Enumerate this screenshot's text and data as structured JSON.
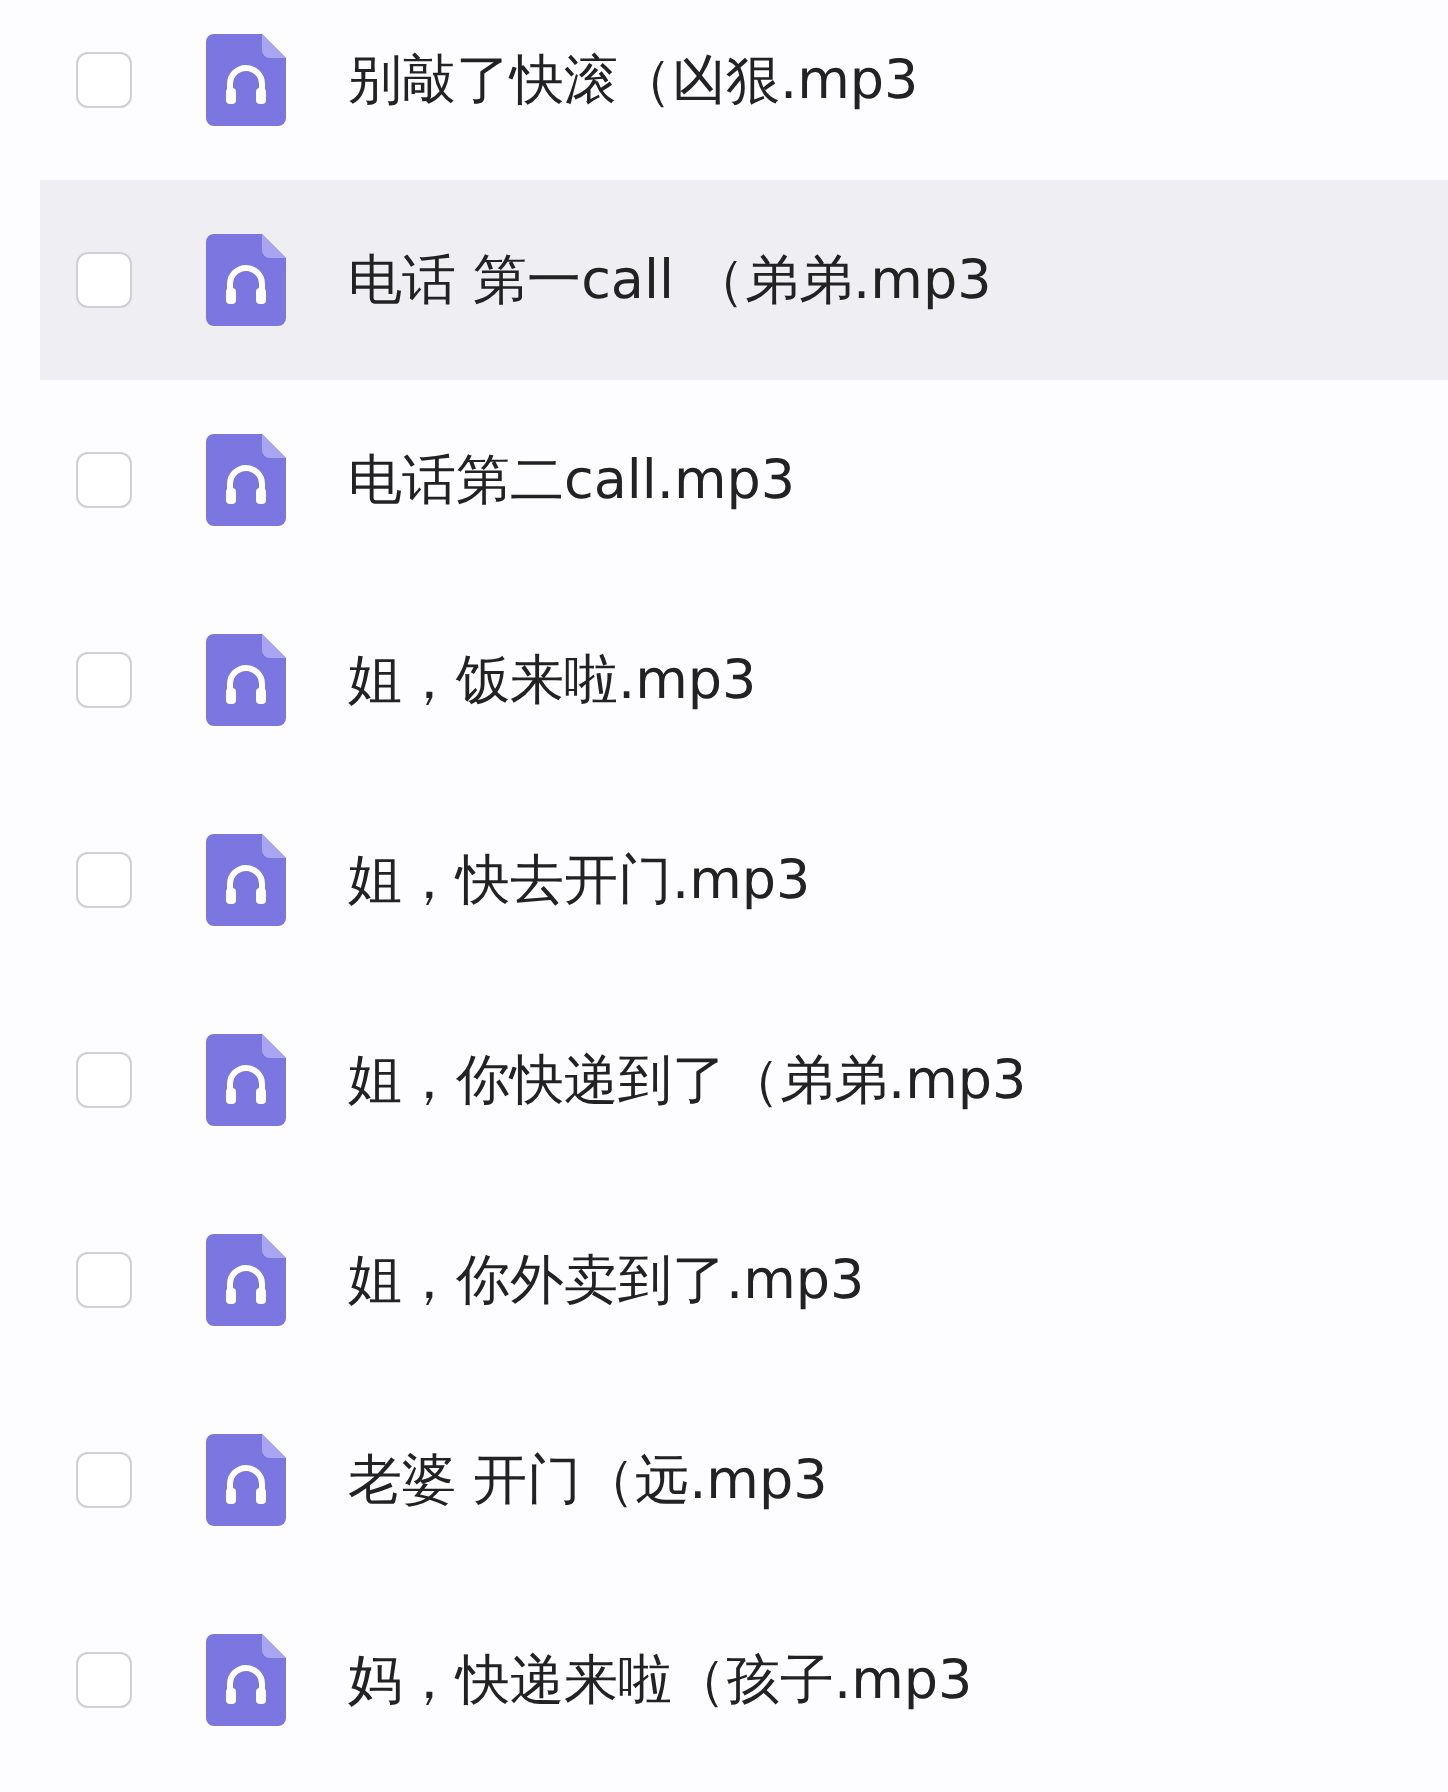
{
  "files": [
    {
      "name": "别敲了快滚（凶狠.mp3",
      "checked": false,
      "hovered": false
    },
    {
      "name": "电话 第一call （弟弟.mp3",
      "checked": false,
      "hovered": true
    },
    {
      "name": "电话第二call.mp3",
      "checked": false,
      "hovered": false
    },
    {
      "name": "姐，饭来啦.mp3",
      "checked": false,
      "hovered": false
    },
    {
      "name": "姐，快去开门.mp3",
      "checked": false,
      "hovered": false
    },
    {
      "name": "姐，你快递到了（弟弟.mp3",
      "checked": false,
      "hovered": false
    },
    {
      "name": "姐，你外卖到了.mp3",
      "checked": false,
      "hovered": false
    },
    {
      "name": "老婆 开门（远.mp3",
      "checked": false,
      "hovered": false
    },
    {
      "name": "妈，快递来啦（孩子.mp3",
      "checked": false,
      "hovered": false
    }
  ]
}
